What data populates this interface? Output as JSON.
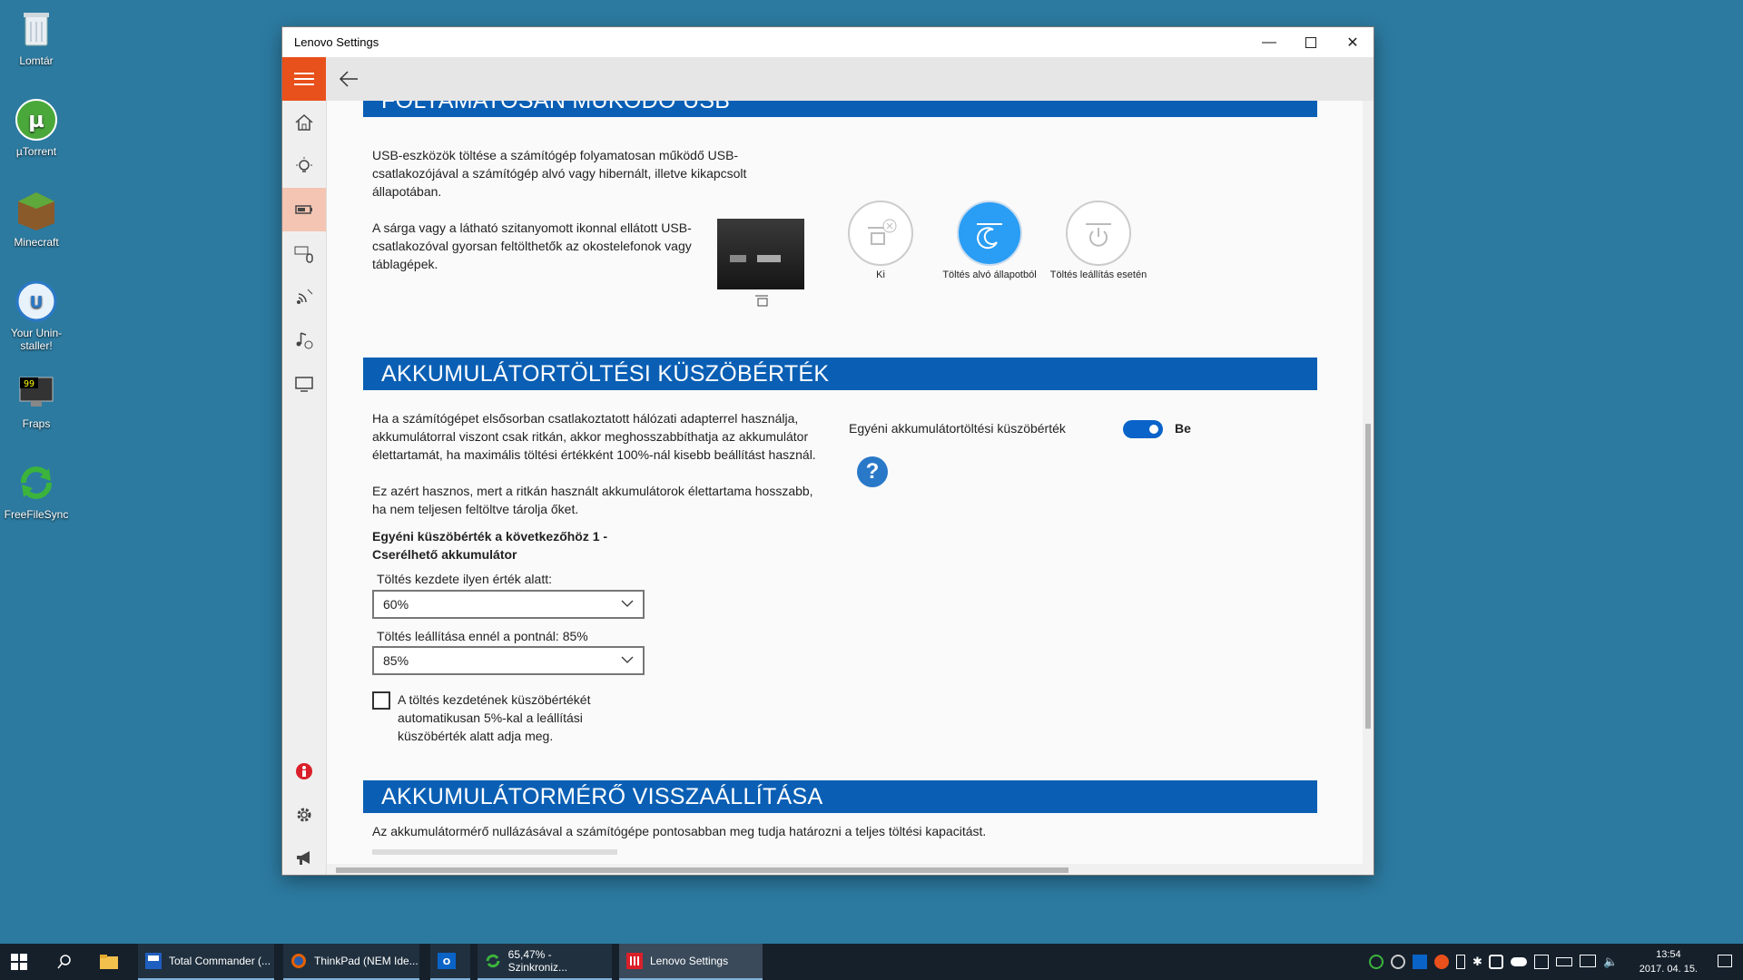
{
  "desktop": {
    "icons": [
      {
        "label": "Lomtár",
        "icon": "recycle-bin-icon"
      },
      {
        "label": "µTorrent",
        "icon": "utorrent-icon"
      },
      {
        "label": "Minecraft",
        "icon": "minecraft-icon"
      },
      {
        "label": "Your Unin-staller!",
        "icon": "uninstaller-icon"
      },
      {
        "label": "Fraps",
        "icon": "fraps-icon"
      },
      {
        "label": "FreeFileSync",
        "icon": "freefilesync-icon"
      }
    ]
  },
  "window": {
    "title": "Lenovo Settings",
    "accent": "#e8501c",
    "section_color": "#0a5fb4"
  },
  "usb_section": {
    "title": "FOLYAMATOSAN MŰKÖDŐ USB",
    "desc1_line1": "USB-eszközök töltése a számítógép folyamatosan működő USB-",
    "desc1_line2": "csatlakozójával a számítógép alvó vagy hibernált, illetve kikapcsolt",
    "desc1_line3": "állapotában.",
    "desc2_line1": "A sárga vagy a látható szitanyomott ikonnal ellátott USB-",
    "desc2_line2": "csatlakozóval gyorsan feltölthetők az okostelefonok vagy",
    "desc2_line3": "táblagépek.",
    "options": [
      {
        "label": "Ki",
        "selected": false
      },
      {
        "label": "Töltés alvó állapotból",
        "selected": true
      },
      {
        "label": "Töltés leállítás esetén",
        "selected": false
      }
    ]
  },
  "battery_threshold": {
    "title": "AKKUMULÁTORTÖLTÉSI KÜSZÖBÉRTÉK",
    "p1_line1": "Ha a számítógépet elsősorban csatlakoztatott hálózati adapterrel használja,",
    "p1_line2": "akkumulátorral viszont csak ritkán, akkor meghosszabbíthatja az akkumulátor",
    "p1_line3": "élettartamát, ha maximális töltési értékként 100%-nál kisebb beállítást használ.",
    "p2_line1": "Ez azért hasznos, mert a ritkán használt akkumulátorok élettartama hosszabb,",
    "p2_line2": "ha nem teljesen feltöltve tárolja őket.",
    "custom_heading_line1": "Egyéni küszöbérték a következőhöz 1 -",
    "custom_heading_line2": "Cserélhető akkumulátor",
    "start_label": "Töltés kezdete ilyen érték alatt:",
    "start_value": "60%",
    "stop_label": "Töltés leállítása ennél a pontnál: 85%",
    "stop_value": "85%",
    "auto_line1": "A töltés kezdetének küszöbértékét",
    "auto_line2": "automatikusan 5%-kal a leállítási",
    "auto_line3": "küszöbérték alatt adja meg.",
    "toggle_label": "Egyéni akkumulátortöltési küszöbérték",
    "toggle_state": "Be"
  },
  "gauge_reset": {
    "title": "AKKUMULÁTORMÉRŐ VISSZAÁLLÍTÁSA",
    "desc": "Az akkumulátormérő nullázásával a számítógépe pontosabban meg tudja határozni a teljes töltési kapacitást."
  },
  "taskbar": {
    "apps": [
      {
        "label": "Total Commander (...",
        "icon": "total-commander-icon"
      },
      {
        "label": "ThinkPad (NEM Ide...",
        "icon": "firefox-icon"
      },
      {
        "label": "",
        "icon": "outlook-icon"
      },
      {
        "label": "65,47% - Szinkroniz...",
        "icon": "freefilesync-icon"
      },
      {
        "label": "Lenovo Settings",
        "icon": "lenovo-settings-icon"
      }
    ],
    "time": "13:54",
    "date": "2017. 04. 15."
  }
}
